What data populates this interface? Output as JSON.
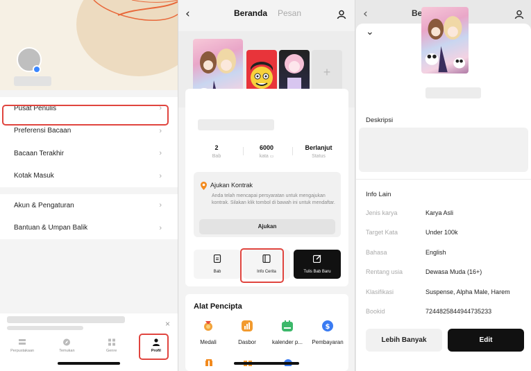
{
  "profile_screen": {
    "menu": [
      {
        "label": "Pusat Penulis"
      },
      {
        "label": "Preferensi Bacaan"
      },
      {
        "label": "Bacaan Terakhir"
      },
      {
        "label": "Kotak Masuk"
      },
      {
        "label": "Akun & Pengaturan"
      },
      {
        "label": "Bantuan & Umpan Balik"
      }
    ],
    "chevron": "›",
    "close_glyph": "×",
    "tabs": [
      {
        "label": "Perpustakaan",
        "icon": "library-icon"
      },
      {
        "label": "Temukan",
        "icon": "compass-icon"
      },
      {
        "label": "Genre",
        "icon": "grid-icon"
      },
      {
        "label": "Profil",
        "icon": "person-icon"
      }
    ]
  },
  "story_screen": {
    "back_glyph": "‹",
    "tab_active": "Beranda",
    "tab_inactive": "Pesan",
    "add_cover_glyph": "+",
    "stats": [
      {
        "value": "2",
        "label": "Bab"
      },
      {
        "value": "6000",
        "label": "kata"
      },
      {
        "value": "Berlanjut",
        "label": "Status"
      }
    ],
    "contract": {
      "title": "Ajukan Kontrak",
      "body": "Anda telah mencapai persyaratan untuk mengajukan kontrak. Silakan klik tombol di bawah ini untuk mendaftar.",
      "button": "Ajukan"
    },
    "actions": [
      {
        "label": "Bab",
        "icon": "document-icon"
      },
      {
        "label": "Info Cerita",
        "icon": "book-icon"
      },
      {
        "label": "Tulis Bab Baru",
        "icon": "edit-icon"
      }
    ],
    "tools_title": "Alat Pencipta",
    "tools": [
      {
        "label": "Medali",
        "color": "#f2a23a"
      },
      {
        "label": "Dasbor",
        "color": "#f29a2e"
      },
      {
        "label": "kalender p...",
        "color": "#3cb86a"
      },
      {
        "label": "Pembayaran",
        "color": "#3a7bf2"
      }
    ]
  },
  "info_screen": {
    "back_glyph": "‹",
    "tab_active_partial": "Be",
    "collapse_glyph": "⌄",
    "deskripsi_title": "Deskripsi",
    "info_lain_title": "Info Lain",
    "info": [
      {
        "key": "Jenis karya",
        "value": "Karya Asli"
      },
      {
        "key": "Target Kata",
        "value": "Under 100k"
      },
      {
        "key": "Bahasa",
        "value": "English"
      },
      {
        "key": "Rentang usia",
        "value": "Dewasa Muda (16+)"
      },
      {
        "key": "Klasifikasi",
        "value": "Suspense, Alpha Male, Harem"
      },
      {
        "key": "Bookid",
        "value": "7244825844944735233"
      }
    ],
    "more_button": "Lebih Banyak",
    "edit_button": "Edit"
  },
  "colors": {
    "highlight": "#e0443e",
    "dark_button": "#111111",
    "accent_orange": "#f28a1e"
  }
}
